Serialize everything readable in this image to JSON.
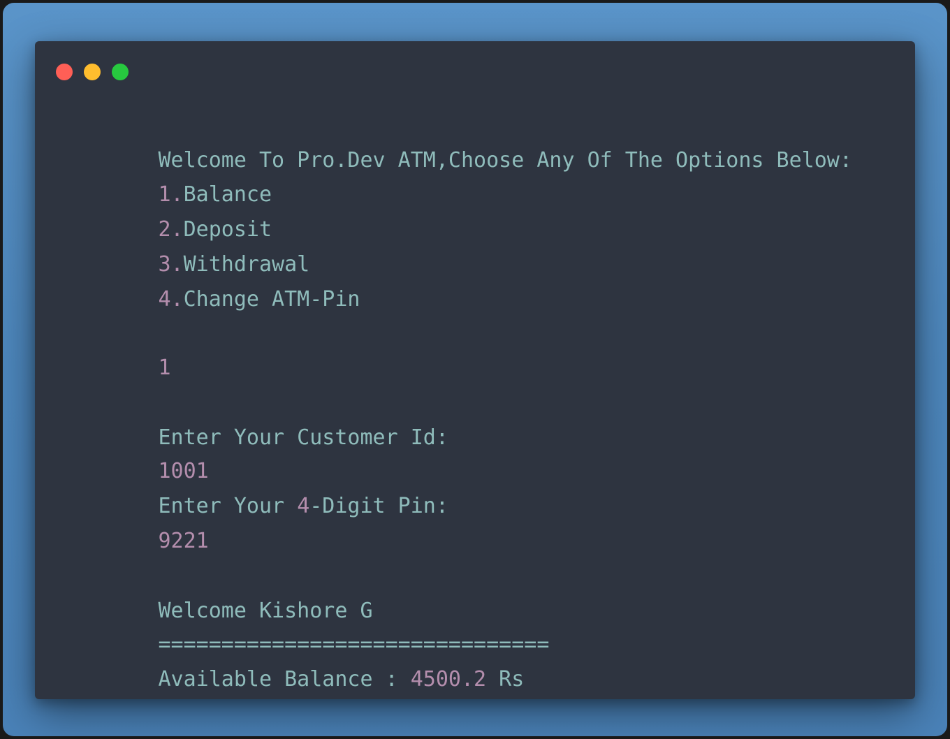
{
  "colors": {
    "background": "#4d87bd",
    "terminal_bg": "#2e3440",
    "text": "#8fbcbb",
    "number": "#b48ead",
    "close": "#ff5f56",
    "minimize": "#ffbd2e",
    "maximize": "#27c93f"
  },
  "window_controls": [
    "close-dot",
    "minimize-dot",
    "maximize-dot"
  ],
  "output": {
    "welcome_menu": "Welcome To Pro.Dev ATM,Choose Any Of The Options Below:",
    "options": [
      {
        "num": "1.",
        "label": "Balance"
      },
      {
        "num": "2.",
        "label": "Deposit"
      },
      {
        "num": "3.",
        "label": "Withdrawal"
      },
      {
        "num": "4.",
        "label": "Change ATM-Pin"
      }
    ],
    "choice": "1",
    "customer_id_prompt": "Enter Your Customer Id:",
    "customer_id": "1001",
    "pin_prompt_prefix": "Enter Your ",
    "pin_prompt_digit": "4",
    "pin_prompt_suffix": "-Digit Pin:",
    "pin": "9221",
    "welcome_user": "Welcome Kishore G",
    "divider": "===============================",
    "balance_label": "Available Balance : ",
    "balance_value": "4500.2",
    "balance_unit": " Rs"
  }
}
